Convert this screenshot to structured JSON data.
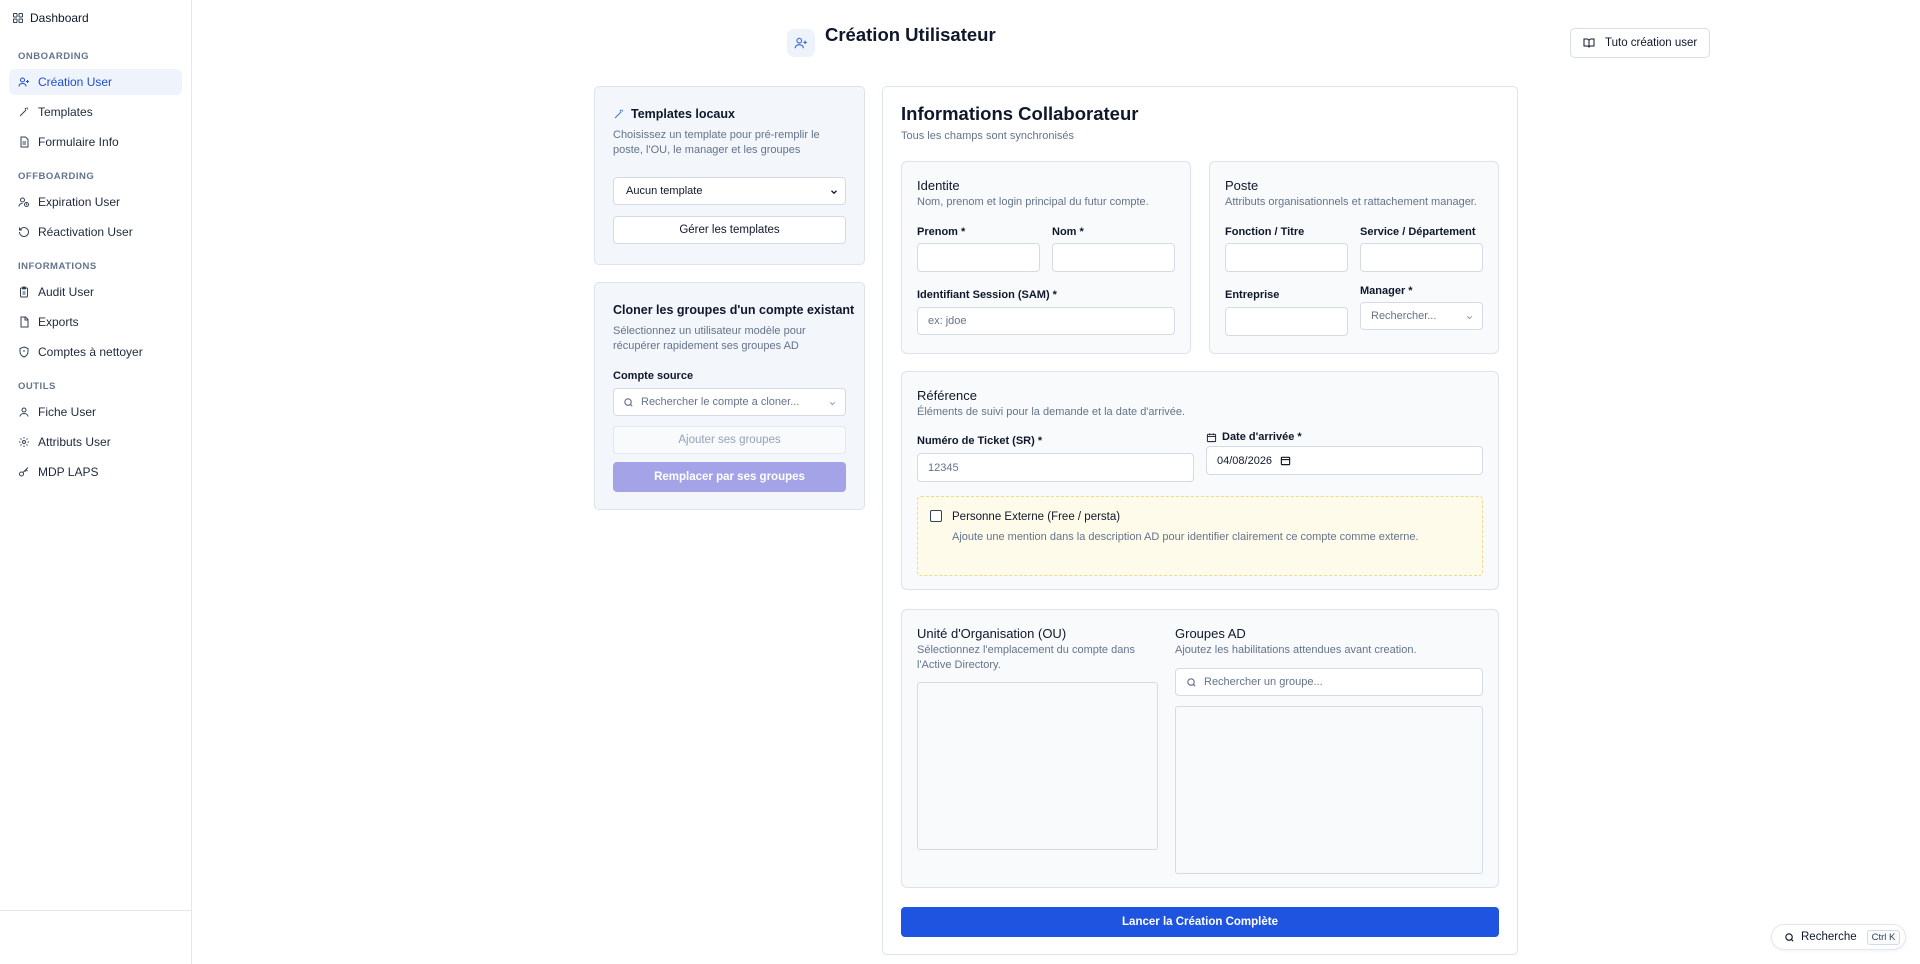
{
  "sidebar": {
    "top": {
      "label": "Dashboard"
    },
    "sections": [
      {
        "title": "ONBOARDING",
        "items": [
          {
            "label": "Création User",
            "active": true
          },
          {
            "label": "Templates"
          },
          {
            "label": "Formulaire Info"
          }
        ]
      },
      {
        "title": "OFFBOARDING",
        "items": [
          {
            "label": "Expiration User"
          },
          {
            "label": "Réactivation User"
          }
        ]
      },
      {
        "title": "INFORMATIONS",
        "items": [
          {
            "label": "Audit User"
          },
          {
            "label": "Exports"
          },
          {
            "label": "Comptes à nettoyer"
          }
        ]
      },
      {
        "title": "OUTILS",
        "items": [
          {
            "label": "Fiche User"
          },
          {
            "label": "Attributs User"
          },
          {
            "label": "MDP LAPS"
          }
        ]
      }
    ]
  },
  "header": {
    "title": "Création Utilisateur",
    "tuto_label": "Tuto création user"
  },
  "templates_card": {
    "title": "Templates locaux",
    "desc1": "Choisissez un template pour pré-remplir le",
    "desc2": "poste, l'OU, le manager et les groupes",
    "select_value": "Aucun template",
    "manage_label": "Gérer les templates"
  },
  "clone_card": {
    "title": "Cloner les groupes d'un compte existant",
    "desc1": "Sélectionnez un utilisateur modèle pour",
    "desc2": "récupérer rapidement ses groupes AD",
    "source_label": "Compte source",
    "source_placeholder": "Rechercher le compte a cloner...",
    "add_label": "Ajouter ses groupes",
    "replace_label": "Remplacer par ses groupes"
  },
  "info": {
    "title": "Informations Collaborateur",
    "subtitle": "Tous les champs sont synchronisés",
    "identite": {
      "title": "Identite",
      "desc": "Nom, prenom et login principal du futur compte.",
      "prenom_label": "Prenom *",
      "nom_label": "Nom *",
      "sam_label": "Identifiant Session (SAM) *",
      "sam_placeholder": "ex: jdoe"
    },
    "poste": {
      "title": "Poste",
      "desc": "Attributs organisationnels et rattachement manager.",
      "fonction_label": "Fonction / Titre",
      "service_label": "Service / Département",
      "entreprise_label": "Entreprise",
      "manager_label": "Manager *",
      "manager_placeholder": "Rechercher..."
    },
    "reference": {
      "title": "Référence",
      "desc": "Éléments de suivi pour la demande et la date d'arrivée.",
      "ticket_label": "Numéro de Ticket (SR) *",
      "ticket_placeholder": "12345",
      "date_label": "Date d'arrivée *",
      "date_value": "04/08/2026",
      "externe_label": "Personne Externe (Free / persta)",
      "externe_desc": "Ajoute une mention dans la description AD pour identifier clairement ce compte comme externe."
    },
    "ou": {
      "title": "Unité d'Organisation (OU)",
      "desc1": "Sélectionnez l'emplacement du compte dans",
      "desc2": "l'Active Directory."
    },
    "groups": {
      "title": "Groupes AD",
      "desc": "Ajoutez les habilitations attendues avant creation.",
      "search_placeholder": "Rechercher un groupe..."
    },
    "submit_label": "Lancer la Création Complète"
  },
  "global_search": {
    "label": "Recherche",
    "shortcut": "Ctrl K"
  },
  "colors": {
    "primary": "#1f54e0",
    "violet": "#a5a3e8",
    "active_bg": "#eff4fc",
    "warning_bg": "#fefbeb"
  }
}
